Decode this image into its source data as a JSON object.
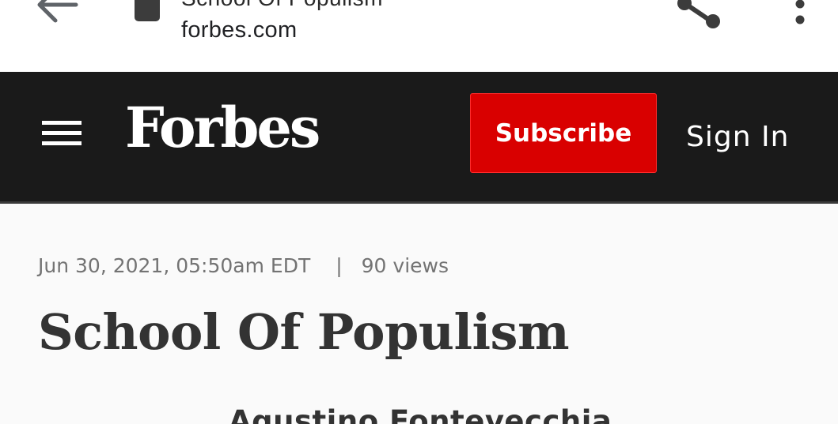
{
  "browser": {
    "tab_title": "School Of Populism",
    "domain": "forbes.com",
    "icons": {
      "back": "arrow-left-icon",
      "lock": "lock-icon",
      "share": "share-icon",
      "menu": "more-vertical-icon"
    }
  },
  "header": {
    "logo": "Forbes",
    "subscribe_label": "Subscribe",
    "signin_label": "Sign In",
    "menu_icon": "hamburger-menu-icon"
  },
  "article": {
    "date": "Jun 30, 2021, 05:50am EDT",
    "separator": "|",
    "views": "90 views",
    "title": "School Of Populism",
    "author": "Agustino Fontevecchia"
  },
  "colors": {
    "header_bg": "#1a1a1a",
    "subscribe_bg": "#d90000",
    "page_bg": "#fafafa",
    "meta_text": "#737373",
    "title_text": "#333333"
  }
}
